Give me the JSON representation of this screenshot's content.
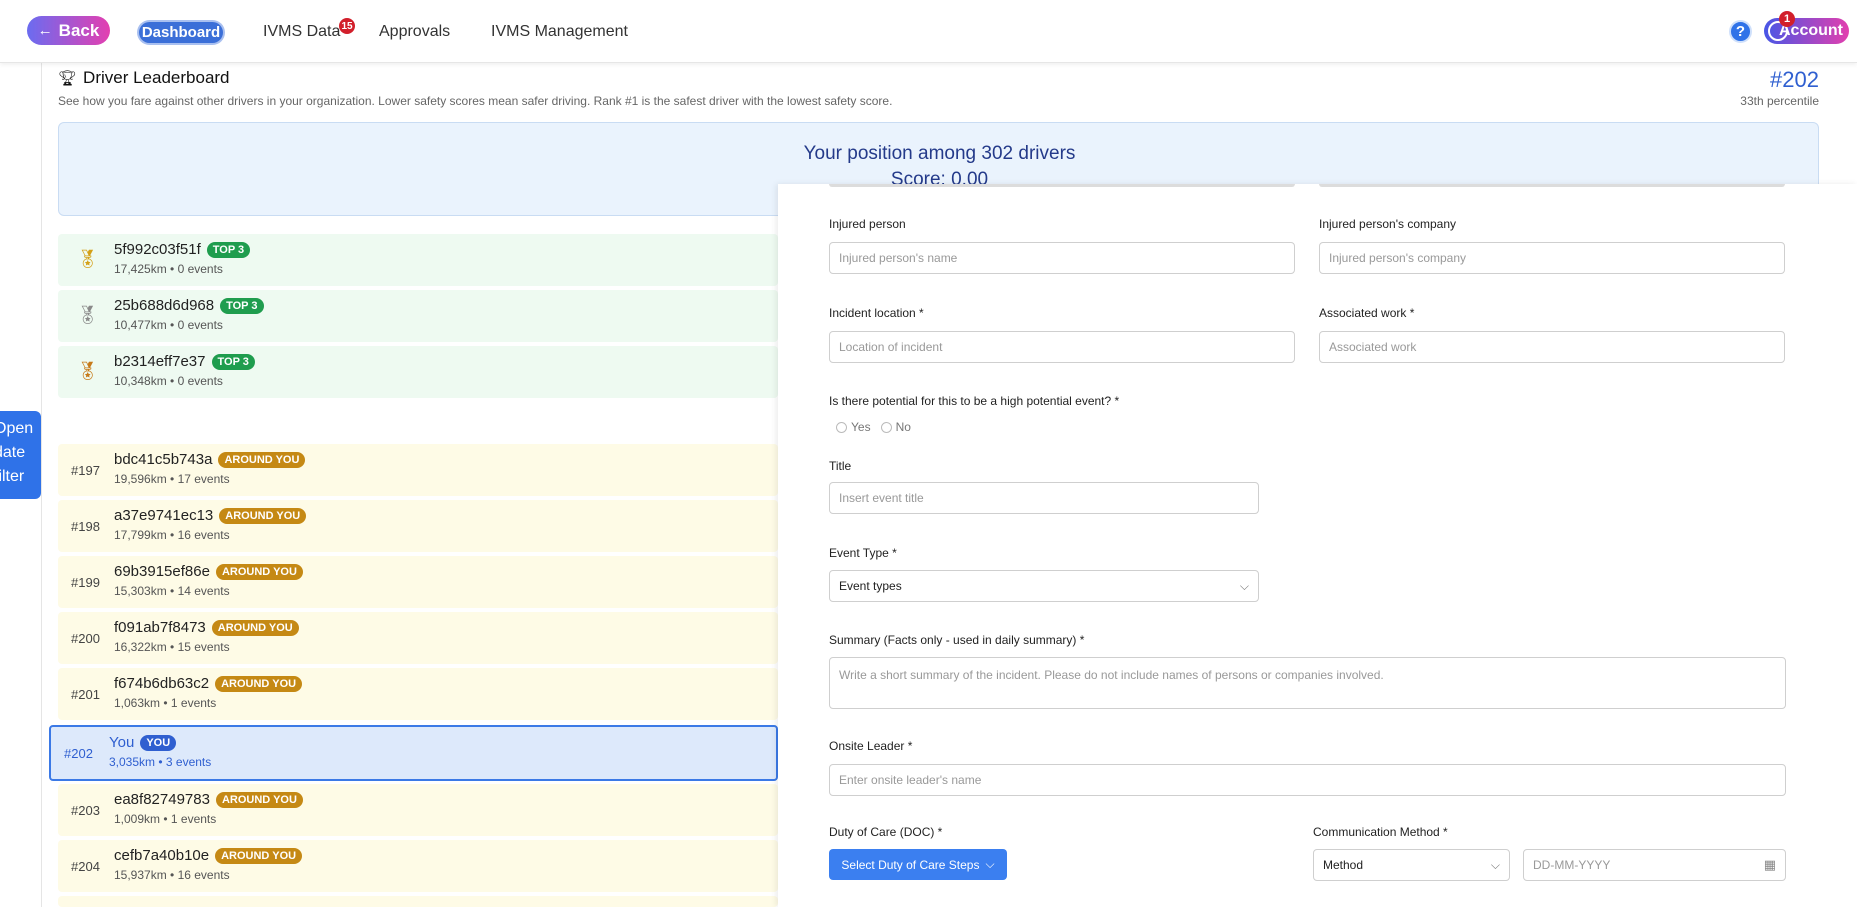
{
  "nav": {
    "back_label": "Back",
    "dashboard_label": "Dashboard",
    "ivms_data_label": "IVMS Data",
    "ivms_data_badge": "15",
    "approvals_label": "Approvals",
    "ivms_management_label": "IVMS Management",
    "help_label": "?",
    "account_label": "Account",
    "account_badge": "1"
  },
  "filter_tab": {
    "line1": "Open",
    "line2": "date",
    "line3": "filter"
  },
  "leaderboard": {
    "title": "Driver Leaderboard",
    "description": "See how you fare against other drivers in your organization. Lower safety scores mean safer driving. Rank #1 is the safest driver with the lowest safety score.",
    "rank": "#202",
    "percentile": "33th percentile",
    "position_title": "Your position among 302 drivers",
    "position_score": "Score: 0.00",
    "top": [
      {
        "name": "5f992c03f51f",
        "badge": "TOP 3",
        "meta": "17,425km • 0 events",
        "medal": "gold"
      },
      {
        "name": "25b688d6d968",
        "badge": "TOP 3",
        "meta": "10,477km • 0 events",
        "medal": "silver"
      },
      {
        "name": "b2314eff7e37",
        "badge": "TOP 3",
        "meta": "10,348km • 0 events",
        "medal": "bronze"
      }
    ],
    "around": [
      {
        "rank": "#197",
        "name": "bdc41c5b743a",
        "badge": "AROUND YOU",
        "meta": "19,596km • 17 events"
      },
      {
        "rank": "#198",
        "name": "a37e9741ec13",
        "badge": "AROUND YOU",
        "meta": "17,799km • 16 events"
      },
      {
        "rank": "#199",
        "name": "69b3915ef86e",
        "badge": "AROUND YOU",
        "meta": "15,303km • 14 events"
      },
      {
        "rank": "#200",
        "name": "f091ab7f8473",
        "badge": "AROUND YOU",
        "meta": "16,322km • 15 events"
      },
      {
        "rank": "#201",
        "name": "f674b6db63c2",
        "badge": "AROUND YOU",
        "meta": "1,063km • 1 events"
      }
    ],
    "you": {
      "rank": "#202",
      "name": "You",
      "badge": "YOU",
      "meta": "3,035km • 3 events"
    },
    "after": [
      {
        "rank": "#203",
        "name": "ea8f82749783",
        "badge": "AROUND YOU",
        "meta": "1,009km • 1 events"
      },
      {
        "rank": "#204",
        "name": "cefb7a40b10e",
        "badge": "AROUND YOU",
        "meta": "15,937km • 16 events"
      }
    ]
  },
  "form": {
    "injured_person_label": "Injured person",
    "injured_person_placeholder": "Injured person's name",
    "injured_company_label": "Injured person's company",
    "injured_company_placeholder": "Injured person's company",
    "incident_location_label": "Incident location *",
    "incident_location_placeholder": "Location of incident",
    "associated_work_label": "Associated work *",
    "associated_work_placeholder": "Associated work",
    "high_potential_label": "Is there potential for this to be a high potential event? *",
    "yes_label": "Yes",
    "no_label": "No",
    "title_label": "Title",
    "title_placeholder": "Insert event title",
    "event_type_label": "Event Type *",
    "event_type_value": "Event types",
    "summary_label": "Summary (Facts only - used in daily summary) *",
    "summary_placeholder": "Write a short summary of the incident. Please do not include names of persons or companies involved.",
    "onsite_leader_label": "Onsite Leader *",
    "onsite_leader_placeholder": "Enter onsite leader's name",
    "doc_label": "Duty of Care (DOC) *",
    "doc_button": "Select Duty of Care Steps",
    "comm_method_label": "Communication Method *",
    "method_value": "Method",
    "date_placeholder": "DD-MM-YYYY"
  }
}
